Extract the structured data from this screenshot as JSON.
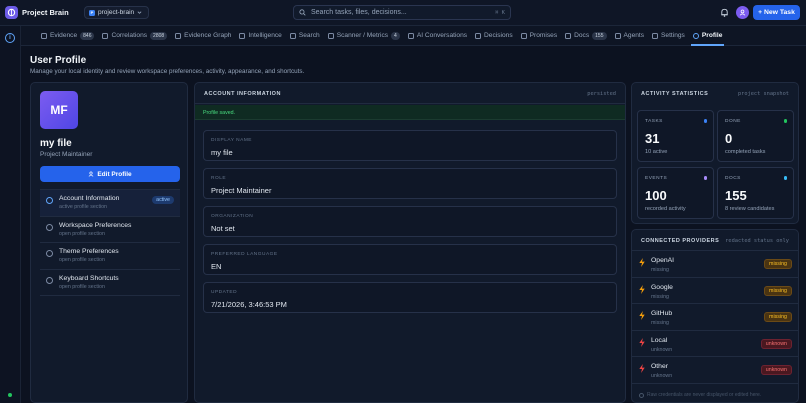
{
  "app": {
    "title": "Project Brain",
    "project": "project-brain"
  },
  "search": {
    "placeholder": "Search tasks, files, decisions...",
    "shortcut": "⌘ K"
  },
  "header": {
    "new_task_label": "+ New Task"
  },
  "tabs": [
    {
      "label": "Evidence",
      "badge": "846"
    },
    {
      "label": "Correlations",
      "badge": "2808"
    },
    {
      "label": "Evidence Graph"
    },
    {
      "label": "Intelligence"
    },
    {
      "label": "Search"
    },
    {
      "label": "Scanner / Metrics",
      "badge": "4"
    },
    {
      "label": "AI Conversations"
    },
    {
      "label": "Decisions"
    },
    {
      "label": "Promises"
    },
    {
      "label": "Docs",
      "badge": "155"
    },
    {
      "label": "Agents"
    },
    {
      "label": "Settings"
    },
    {
      "label": "Profile",
      "active": true
    }
  ],
  "page": {
    "title": "User Profile",
    "subtitle": "Manage your local identity and review workspace preferences, activity, appearance, and shortcuts."
  },
  "profile": {
    "initials": "MF",
    "name": "my file",
    "role": "Project Maintainer",
    "edit_label": "Edit Profile",
    "nav": [
      {
        "label": "Account Information",
        "sub": "active profile section",
        "badge": "active"
      },
      {
        "label": "Workspace Preferences",
        "sub": "open profile section"
      },
      {
        "label": "Theme Preferences",
        "sub": "open profile section"
      },
      {
        "label": "Keyboard Shortcuts",
        "sub": "open profile section"
      }
    ]
  },
  "account": {
    "title": "ACCOUNT INFORMATION",
    "status": "persisted",
    "saved_message": "Profile saved.",
    "fields": [
      {
        "label": "DISPLAY NAME",
        "value": "my file"
      },
      {
        "label": "ROLE",
        "value": "Project Maintainer"
      },
      {
        "label": "ORGANIZATION",
        "value": "Not set"
      },
      {
        "label": "PREFERRED LANGUAGE",
        "value": "EN"
      },
      {
        "label": "UPDATED",
        "value": "7/21/2026, 3:46:53 PM"
      }
    ]
  },
  "activity": {
    "title": "ACTIVITY STATISTICS",
    "note": "project snapshot",
    "stats": [
      {
        "label": "TASKS",
        "value": "31",
        "sub": "10 active",
        "color": "#3b82f6"
      },
      {
        "label": "DONE",
        "value": "0",
        "sub": "completed tasks",
        "color": "#22c55e"
      },
      {
        "label": "EVENTS",
        "value": "100",
        "sub": "recorded activity",
        "color": "#a78bfa"
      },
      {
        "label": "DOCS",
        "value": "155",
        "sub": "8 review candidates",
        "color": "#38bdf8"
      }
    ]
  },
  "providers": {
    "title": "CONNECTED PROVIDERS",
    "note": "redacted status only",
    "items": [
      {
        "name": "OpenAI",
        "sub": "missing",
        "badge": "missing",
        "color": "#f59e0b"
      },
      {
        "name": "Google",
        "sub": "missing",
        "badge": "missing",
        "color": "#f59e0b"
      },
      {
        "name": "GitHub",
        "sub": "missing",
        "badge": "missing",
        "color": "#f59e0b"
      },
      {
        "name": "Local",
        "sub": "unknown",
        "badge": "unknown",
        "color": "#ef4444"
      },
      {
        "name": "Other",
        "sub": "unknown",
        "badge": "unknown",
        "color": "#ef4444"
      }
    ],
    "footer": "Raw credentials are never displayed or edited here."
  }
}
